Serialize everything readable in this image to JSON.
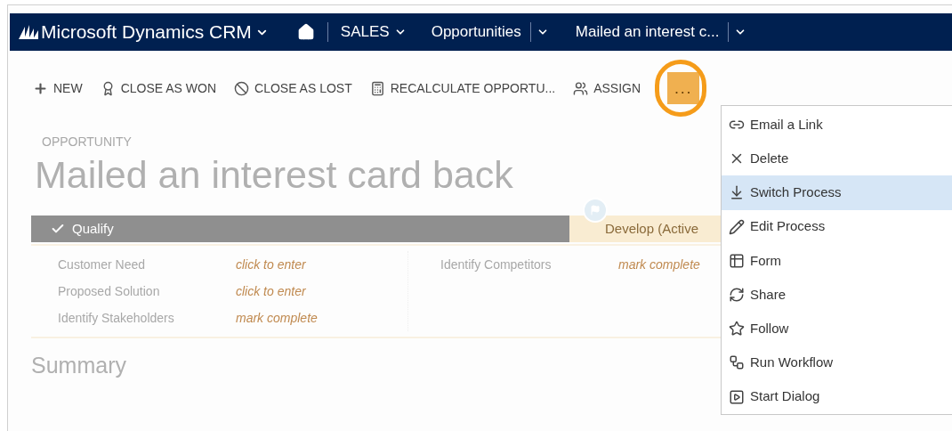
{
  "nav": {
    "app_title": "Microsoft Dynamics CRM",
    "area": "SALES",
    "entity": "Opportunities",
    "record": "Mailed an interest c..."
  },
  "toolbar": [
    {
      "kind": "new",
      "label": "NEW"
    },
    {
      "kind": "won",
      "label": "CLOSE AS WON"
    },
    {
      "kind": "lost",
      "label": "CLOSE AS LOST"
    },
    {
      "kind": "recalculate",
      "label": "RECALCULATE OPPORTU..."
    },
    {
      "kind": "assign",
      "label": "ASSIGN"
    }
  ],
  "more_button": {
    "label": "...",
    "highlighted": true
  },
  "record": {
    "entity_label": "OPPORTUNITY",
    "title": "Mailed an interest card back"
  },
  "process": {
    "stages": [
      {
        "label": "Qualify",
        "completed": true,
        "selected": false
      },
      {
        "label": "Develop (Active",
        "completed": false,
        "selected": true
      }
    ],
    "columns": [
      [
        {
          "label": "Customer Need",
          "value": "click to enter"
        },
        {
          "label": "Proposed Solution",
          "value": "click to enter"
        },
        {
          "label": "Identify Stakeholders",
          "value": "mark complete"
        }
      ],
      [
        {
          "label": "Identify Competitors",
          "value": "mark complete"
        }
      ]
    ]
  },
  "section_heading": "Summary",
  "menu": [
    {
      "kind": "link",
      "label": "Email a Link",
      "selected": false
    },
    {
      "kind": "delete",
      "label": "Delete",
      "selected": false
    },
    {
      "kind": "switch",
      "label": "Switch Process",
      "selected": true
    },
    {
      "kind": "edit",
      "label": "Edit Process",
      "selected": false
    },
    {
      "kind": "form",
      "label": "Form",
      "selected": false
    },
    {
      "kind": "share",
      "label": "Share",
      "selected": false
    },
    {
      "kind": "follow",
      "label": "Follow",
      "selected": false
    },
    {
      "kind": "workflow",
      "label": "Run Workflow",
      "selected": false
    },
    {
      "kind": "dialog",
      "label": "Start Dialog",
      "selected": false
    }
  ]
}
